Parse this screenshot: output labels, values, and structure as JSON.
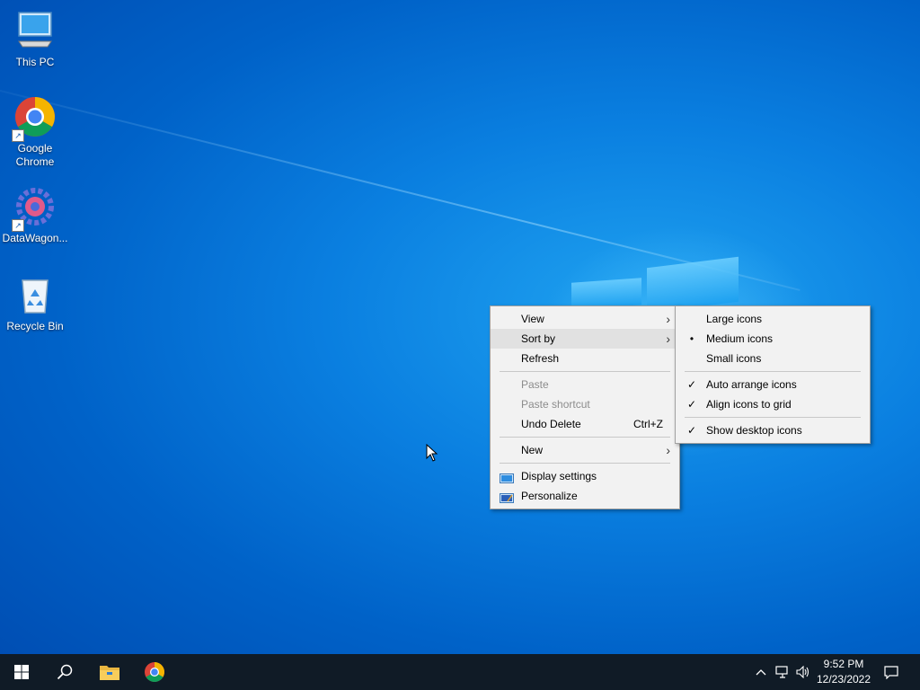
{
  "desktop": {
    "icons": [
      {
        "label": "This PC",
        "icon": "computer-icon"
      },
      {
        "label": "Google\nChrome",
        "line1": "Google",
        "line2": "Chrome",
        "icon": "chrome-icon"
      },
      {
        "label": "DataWagon...",
        "icon": "datawagon-icon"
      },
      {
        "label": "Recycle Bin",
        "icon": "recycle-bin-icon"
      }
    ]
  },
  "context_menu": {
    "items": [
      {
        "label": "View",
        "submenu": true
      },
      {
        "label": "Sort by",
        "submenu": true,
        "highlighted": true
      },
      {
        "label": "Refresh"
      },
      {
        "label": "Paste",
        "disabled": true
      },
      {
        "label": "Paste shortcut",
        "disabled": true
      },
      {
        "label": "Undo Delete",
        "shortcut": "Ctrl+Z"
      },
      {
        "label": "New",
        "submenu": true
      },
      {
        "label": "Display settings",
        "icon": "display-icon"
      },
      {
        "label": "Personalize",
        "icon": "personalize-icon"
      }
    ]
  },
  "view_submenu": {
    "items": [
      {
        "label": "Large icons"
      },
      {
        "label": "Medium icons",
        "mark": "•"
      },
      {
        "label": "Small icons"
      },
      {
        "label": "Auto arrange icons",
        "mark": "✓"
      },
      {
        "label": "Align icons to grid",
        "mark": "✓"
      },
      {
        "label": "Show desktop icons",
        "mark": "✓"
      }
    ]
  },
  "taskbar": {
    "buttons": [
      "windows-start-icon",
      "search-icon",
      "file-explorer-icon",
      "chrome-icon"
    ],
    "tray": [
      "chevron-up-icon",
      "network-icon",
      "volume-icon"
    ],
    "clock": {
      "time": "9:52 PM",
      "date": "12/23/2022"
    },
    "notification_icon": "action-center-icon"
  },
  "colors": {
    "wallpaper": "#0a7fe0",
    "taskbar": "#101b26",
    "menu_bg": "#f2f2f2",
    "menu_highlight": "#e1e1e1"
  }
}
